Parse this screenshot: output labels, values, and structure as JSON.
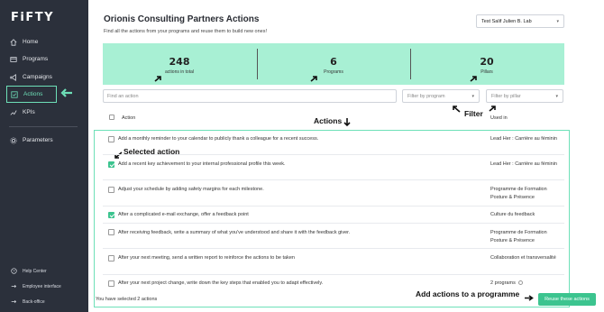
{
  "app": {
    "logo": "FiFTY"
  },
  "sidebar": {
    "items": [
      {
        "label": "Home",
        "icon": "home-icon"
      },
      {
        "label": "Programs",
        "icon": "programs-icon"
      },
      {
        "label": "Campaigns",
        "icon": "campaigns-icon"
      },
      {
        "label": "Actions",
        "icon": "actions-icon",
        "active": true
      },
      {
        "label": "KPIs",
        "icon": "kpis-icon"
      },
      {
        "label": "Parameters",
        "icon": "gear-icon"
      }
    ],
    "bottom": [
      {
        "label": "Help Center",
        "icon": "help-icon"
      },
      {
        "label": "Employee interface",
        "icon": "switch-icon"
      },
      {
        "label": "Back-office",
        "icon": "backoffice-icon"
      }
    ]
  },
  "header": {
    "title": "Orionis Consulting Partners Actions",
    "subtitle": "Find all the actions from your programs and reuse them to build new ones!",
    "user_selector": "Test Salif Julien B. Lab"
  },
  "stats": [
    {
      "value": "248",
      "label": "actions in total"
    },
    {
      "value": "6",
      "label": "Programs"
    },
    {
      "value": "20",
      "label": "Pillars"
    }
  ],
  "filters": {
    "search_placeholder": "Find an action",
    "program_placeholder": "Filter by program",
    "pillar_placeholder": "Filter by pillar"
  },
  "annotations": {
    "actions": "Actions",
    "filter": "Filter",
    "selected_action": "Selected action",
    "add_actions": "Add actions to a programme"
  },
  "table": {
    "col_action": "Action",
    "col_used_in": "Used in",
    "rows": [
      {
        "action": "Add a monthly reminder to your calendar to publicly thank a colleague for a recent success.",
        "used_in": "Lead Her : Carrière au féminin",
        "checked": false
      },
      {
        "action": "Add a recent key achievement to your internal professional profile this week.",
        "used_in": "Lead Her : Carrière au féminin",
        "checked": true
      },
      {
        "action": "Adjust your schedule by adding safety margins for each milestone.",
        "used_in": "Programme de Formation Posture & Présence",
        "checked": false
      },
      {
        "action": "After a complicated e-mail exchange, offer a feedback point",
        "used_in": "Culture du feedback",
        "checked": true
      },
      {
        "action": "After receiving feedback, write a summary of what you've understood and share it with the feedback giver.",
        "used_in": "Programme de Formation Posture & Présence",
        "checked": false
      },
      {
        "action": "After your next meeting, send a written report to reinforce the actions to be taken",
        "used_in": "Collaboration et transversalité",
        "checked": false
      },
      {
        "action": "After your next project change, write down the key steps that enabled you to adapt effectively.",
        "used_in": "2 programs",
        "checked": false
      }
    ]
  },
  "footer": {
    "selected_text": "You have selected 2 actions",
    "reuse_button": "Reuse these actions"
  },
  "colors": {
    "sidebar_bg": "#2b303b",
    "accent": "#3cc48f",
    "stats_bg": "#a8f0d4",
    "highlight": "#6ee0b8"
  }
}
